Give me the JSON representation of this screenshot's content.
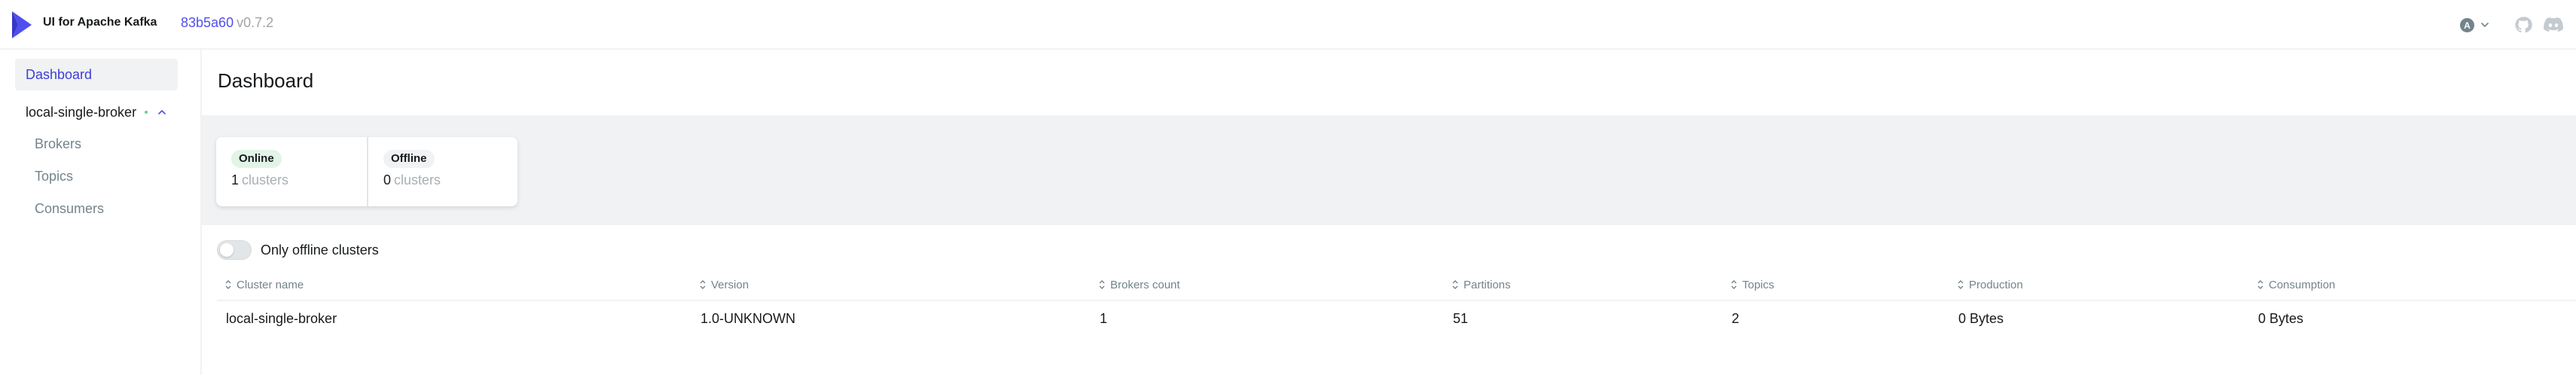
{
  "header": {
    "app_title": "UI for Apache Kafka",
    "commit": "83b5a60",
    "version": "v0.7.2",
    "user_initial": "A"
  },
  "sidebar": {
    "dashboard_label": "Dashboard",
    "cluster_name": "local-single-broker",
    "cluster_status": "online",
    "submenu": [
      "Brokers",
      "Topics",
      "Consumers"
    ]
  },
  "main": {
    "title": "Dashboard",
    "metrics": {
      "online": {
        "label": "Online",
        "value": "1",
        "unit": "clusters"
      },
      "offline": {
        "label": "Offline",
        "value": "0",
        "unit": "clusters"
      }
    },
    "toggle": {
      "label": "Only offline clusters",
      "checked": false
    },
    "table": {
      "columns": [
        "Cluster name",
        "Version",
        "Brokers count",
        "Partitions",
        "Topics",
        "Production",
        "Consumption"
      ],
      "rows": [
        [
          "local-single-broker",
          "1.0-UNKNOWN",
          "1",
          "51",
          "2",
          "0 Bytes",
          "0 Bytes"
        ]
      ]
    }
  },
  "colors": {
    "accent": "#4f4ff0",
    "active_nav": "#3e3ed7",
    "online_badge": "#e2f4e7",
    "status_dot": "#5cd685"
  }
}
